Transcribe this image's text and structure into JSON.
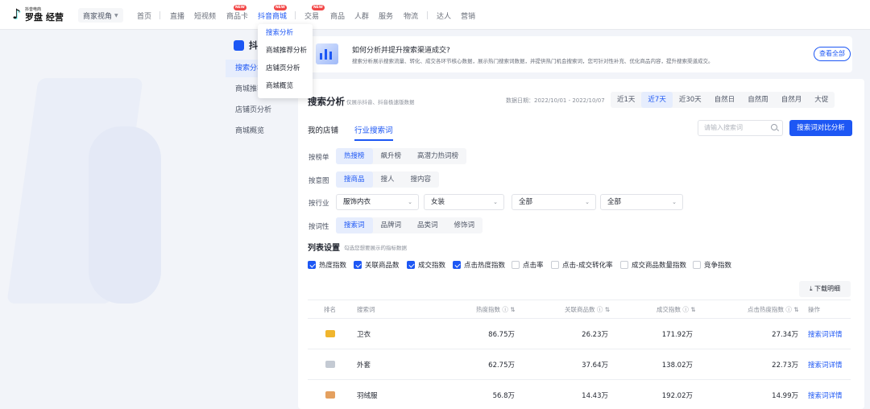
{
  "topbar": {
    "logo_sub": "抖音电商",
    "logo_main": "罗盘 经营",
    "view_select": "商家视角",
    "nav": [
      {
        "label": "首页"
      },
      {
        "label": "直播"
      },
      {
        "label": "短视频"
      },
      {
        "label": "商品卡",
        "badge": "NEW"
      },
      {
        "label": "抖音商城",
        "badge": "NEW",
        "active": true
      },
      {
        "label": "交易",
        "badge": "NEW"
      },
      {
        "label": "商品"
      },
      {
        "label": "人群"
      },
      {
        "label": "服务"
      },
      {
        "label": "物流"
      },
      {
        "label": "达人"
      },
      {
        "label": "营销"
      }
    ]
  },
  "dropdown": {
    "items": [
      "搜索分析",
      "商城推荐分析",
      "店铺页分析",
      "商城概览"
    ],
    "active_index": 0
  },
  "sidebar": {
    "title": "抖",
    "items": [
      "搜索分析",
      "商城推荐",
      "店铺页分析",
      "商城概览"
    ],
    "active_index": 0
  },
  "banner": {
    "title": "如何分析并提升搜索渠道成交?",
    "desc": "搜索分析展示搜索流量、转化、成交各环节核心数据，展示热门搜索词数据，并提供热门机会搜索词，您可针对性补充、优化商品内容，提升搜索渠道成交。",
    "button": "查看全部"
  },
  "main": {
    "title": "搜索分析",
    "subtitle": "仅展示抖音、抖音极速版数据",
    "date": "数据日期：2022/10/01 - 2022/10/07",
    "range_tabs": [
      "近1天",
      "近7天",
      "近30天",
      "自然日",
      "自然周",
      "自然月",
      "大促"
    ],
    "range_active": 1,
    "tabs": [
      "我的店铺",
      "行业搜索词"
    ],
    "tab_active": 1,
    "search_placeholder": "请输入搜索词",
    "compare_button": "搜索词对比分析",
    "filters": {
      "rank": {
        "label": "按榜单",
        "options": [
          "热搜榜",
          "飙升榜",
          "高潜力热词榜"
        ],
        "active": 0
      },
      "intent": {
        "label": "按意图",
        "options": [
          "搜商品",
          "搜人",
          "搜内容"
        ],
        "active": 0
      },
      "industry": {
        "label": "按行业",
        "selects": [
          "服饰内衣",
          "女装",
          "全部",
          "全部"
        ]
      },
      "wordtype": {
        "label": "按词性",
        "options": [
          "搜索词",
          "品牌词",
          "品类词",
          "修饰词"
        ],
        "active": 0
      }
    },
    "columns": {
      "title": "列表设置",
      "subtitle": "勾选您想要展示的指标数据",
      "items": [
        {
          "label": "热度指数",
          "checked": true
        },
        {
          "label": "关联商品数",
          "checked": true
        },
        {
          "label": "成交指数",
          "checked": true
        },
        {
          "label": "点击热度指数",
          "checked": true
        },
        {
          "label": "点击率",
          "checked": false
        },
        {
          "label": "点击-成交转化率",
          "checked": false
        },
        {
          "label": "成交商品数量指数",
          "checked": false
        },
        {
          "label": "竞争指数",
          "checked": false
        }
      ]
    },
    "download": "下载明细",
    "table": {
      "headers": [
        "排名",
        "搜索词",
        "热度指数",
        "关联商品数",
        "成交指数",
        "点击热度指数",
        "操作"
      ],
      "rows": [
        {
          "rank_icon": "gold-crown",
          "word": "卫衣",
          "heat": "86.75万",
          "goods": "26.23万",
          "deal": "171.92万",
          "click": "27.34万",
          "action": "搜索词详情"
        },
        {
          "rank_icon": "silver-crown",
          "word": "外套",
          "heat": "62.75万",
          "goods": "37.64万",
          "deal": "138.02万",
          "click": "22.73万",
          "action": "搜索词详情"
        },
        {
          "rank_icon": "bronze-crown",
          "word": "羽绒服",
          "heat": "56.8万",
          "goods": "14.43万",
          "deal": "192.02万",
          "click": "14.99万",
          "action": "搜索词详情"
        }
      ]
    }
  }
}
